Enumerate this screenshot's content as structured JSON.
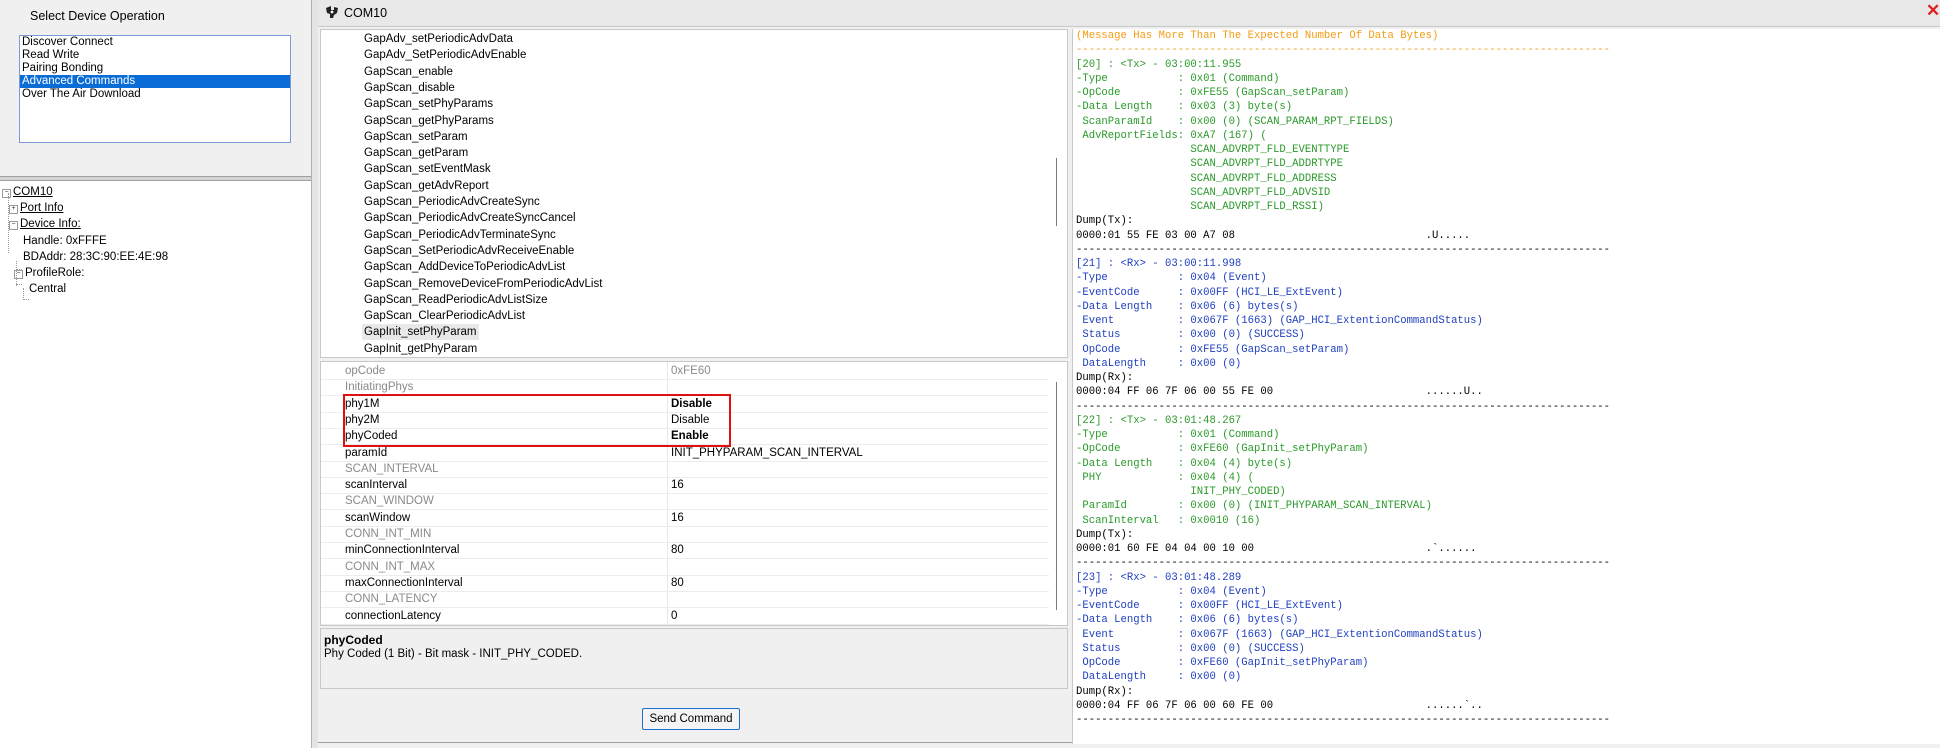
{
  "ops_panel": {
    "title": "Select Device Operation",
    "items": [
      "Discover Connect",
      "Read Write",
      "Pairing Bonding",
      "Advanced Commands",
      "Over The Air Download"
    ],
    "selected_index": 3
  },
  "tree": {
    "root": "COM10",
    "port_info": "Port Info",
    "device_info": "Device Info:",
    "handle": "Handle: 0xFFFE",
    "bdaddr": "BDAddr: 28:3C:90:EE:4E:98",
    "profile_role": "ProfileRole:",
    "role": "Central"
  },
  "window": {
    "title": "COM10"
  },
  "commands": {
    "items": [
      "GapAdv_setPeriodicAdvData",
      "GapAdv_SetPeriodicAdvEnable",
      "GapScan_enable",
      "GapScan_disable",
      "GapScan_setPhyParams",
      "GapScan_getPhyParams",
      "GapScan_setParam",
      "GapScan_getParam",
      "GapScan_setEventMask",
      "GapScan_getAdvReport",
      "GapScan_PeriodicAdvCreateSync",
      "GapScan_PeriodicAdvCreateSyncCancel",
      "GapScan_PeriodicAdvTerminateSync",
      "GapScan_SetPeriodicAdvReceiveEnable",
      "GapScan_AddDeviceToPeriodicAdvList",
      "GapScan_RemoveDeviceFromPeriodicAdvList",
      "GapScan_ReadPeriodicAdvListSize",
      "GapScan_ClearPeriodicAdvList",
      "GapInit_setPhyParam",
      "GapInit_getPhyParam"
    ],
    "selected_index": 18
  },
  "properties": {
    "rows": [
      {
        "name": "opCode",
        "value": "0xFE60",
        "style": "cat"
      },
      {
        "name": "InitiatingPhys",
        "value": "",
        "style": "cat"
      },
      {
        "name": "phy1M",
        "value": "Disable",
        "style": "bold"
      },
      {
        "name": "phy2M",
        "value": "Disable",
        "style": "normal"
      },
      {
        "name": "phyCoded",
        "value": "Enable",
        "style": "bold"
      },
      {
        "name": "paramId",
        "value": "INIT_PHYPARAM_SCAN_INTERVAL",
        "style": "normal"
      },
      {
        "name": "SCAN_INTERVAL",
        "value": "",
        "style": "cat"
      },
      {
        "name": "scanInterval",
        "value": "16",
        "style": "normal"
      },
      {
        "name": "SCAN_WINDOW",
        "value": "",
        "style": "cat"
      },
      {
        "name": "scanWindow",
        "value": "16",
        "style": "normal"
      },
      {
        "name": "CONN_INT_MIN",
        "value": "",
        "style": "cat"
      },
      {
        "name": "minConnectionInterval",
        "value": "80",
        "style": "normal"
      },
      {
        "name": "CONN_INT_MAX",
        "value": "",
        "style": "cat"
      },
      {
        "name": "maxConnectionInterval",
        "value": "80",
        "style": "normal"
      },
      {
        "name": "CONN_LATENCY",
        "value": "",
        "style": "cat"
      },
      {
        "name": "connectionLatency",
        "value": "0",
        "style": "normal"
      }
    ]
  },
  "description": {
    "title": "phyCoded",
    "text": "Phy Coded (1 Bit) - Bit mask - INIT_PHY_CODED."
  },
  "send_button": "Send Command",
  "log": {
    "lines": [
      {
        "t": "(Message Has More Than The Expected Number Of Data Bytes)",
        "c": "orange"
      },
      {
        "t": "------------------------------------------------------------------------------------",
        "c": "orange"
      },
      {
        "t": "[20] : <Tx> - 03:00:11.955",
        "c": "green"
      },
      {
        "t": "-Type           : 0x01 (Command)",
        "c": "green"
      },
      {
        "t": "-OpCode         : 0xFE55 (GapScan_setParam)",
        "c": "green"
      },
      {
        "t": "-Data Length    : 0x03 (3) byte(s)",
        "c": "green"
      },
      {
        "t": " ScanParamId    : 0x00 (0) (SCAN_PARAM_RPT_FIELDS)",
        "c": "green"
      },
      {
        "t": " AdvReportFields: 0xA7 (167) (",
        "c": "green"
      },
      {
        "t": "                  SCAN_ADVRPT_FLD_EVENTTYPE",
        "c": "green"
      },
      {
        "t": "                  SCAN_ADVRPT_FLD_ADDRTYPE",
        "c": "green"
      },
      {
        "t": "                  SCAN_ADVRPT_FLD_ADDRESS",
        "c": "green"
      },
      {
        "t": "                  SCAN_ADVRPT_FLD_ADVSID",
        "c": "green"
      },
      {
        "t": "                  SCAN_ADVRPT_FLD_RSSI)",
        "c": "green"
      },
      {
        "t": "Dump(Tx):",
        "c": "black"
      },
      {
        "t": "0000:01 55 FE 03 00 A7 08                              .U.....",
        "c": "black"
      },
      {
        "t": "------------------------------------------------------------------------------------",
        "c": "black"
      },
      {
        "t": "[21] : <Rx> - 03:00:11.998",
        "c": "blue"
      },
      {
        "t": "-Type           : 0x04 (Event)",
        "c": "blue"
      },
      {
        "t": "-EventCode      : 0x00FF (HCI_LE_ExtEvent)",
        "c": "blue"
      },
      {
        "t": "-Data Length    : 0x06 (6) bytes(s)",
        "c": "blue"
      },
      {
        "t": " Event          : 0x067F (1663) (GAP_HCI_ExtentionCommandStatus)",
        "c": "blue"
      },
      {
        "t": " Status         : 0x00 (0) (SUCCESS)",
        "c": "blue"
      },
      {
        "t": " OpCode         : 0xFE55 (GapScan_setParam)",
        "c": "blue"
      },
      {
        "t": " DataLength     : 0x00 (0)",
        "c": "blue"
      },
      {
        "t": "Dump(Rx):",
        "c": "black"
      },
      {
        "t": "0000:04 FF 06 7F 06 00 55 FE 00                        ......U..",
        "c": "black"
      },
      {
        "t": "------------------------------------------------------------------------------------",
        "c": "black"
      },
      {
        "t": "[22] : <Tx> - 03:01:48.267",
        "c": "green"
      },
      {
        "t": "-Type           : 0x01 (Command)",
        "c": "green"
      },
      {
        "t": "-OpCode         : 0xFE60 (GapInit_setPhyParam)",
        "c": "green"
      },
      {
        "t": "-Data Length    : 0x04 (4) byte(s)",
        "c": "green"
      },
      {
        "t": " PHY            : 0x04 (4) (",
        "c": "green"
      },
      {
        "t": "                  INIT_PHY_CODED)",
        "c": "green"
      },
      {
        "t": " ParamId        : 0x00 (0) (INIT_PHYPARAM_SCAN_INTERVAL)",
        "c": "green"
      },
      {
        "t": " ScanInterval   : 0x0010 (16)",
        "c": "green"
      },
      {
        "t": "Dump(Tx):",
        "c": "black"
      },
      {
        "t": "0000:01 60 FE 04 04 00 10 00                           .`......",
        "c": "black"
      },
      {
        "t": "------------------------------------------------------------------------------------",
        "c": "black"
      },
      {
        "t": "[23] : <Rx> - 03:01:48.289",
        "c": "blue"
      },
      {
        "t": "-Type           : 0x04 (Event)",
        "c": "blue"
      },
      {
        "t": "-EventCode      : 0x00FF (HCI_LE_ExtEvent)",
        "c": "blue"
      },
      {
        "t": "-Data Length    : 0x06 (6) bytes(s)",
        "c": "blue"
      },
      {
        "t": " Event          : 0x067F (1663) (GAP_HCI_ExtentionCommandStatus)",
        "c": "blue"
      },
      {
        "t": " Status         : 0x00 (0) (SUCCESS)",
        "c": "blue"
      },
      {
        "t": " OpCode         : 0xFE60 (GapInit_setPhyParam)",
        "c": "blue"
      },
      {
        "t": " DataLength     : 0x00 (0)",
        "c": "blue"
      },
      {
        "t": "Dump(Rx):",
        "c": "black"
      },
      {
        "t": "0000:04 FF 06 7F 06 00 60 FE 00                        ......`..",
        "c": "black"
      },
      {
        "t": "------------------------------------------------------------------------------------",
        "c": "black"
      }
    ]
  },
  "colors": {
    "selection": "#0a6cd6",
    "highlight_box": "#e01010",
    "log_tx": "#2a9a2a",
    "log_rx": "#1f3fbf",
    "log_warning": "#f39c12"
  },
  "icons": {
    "app": "ti-logo-icon",
    "close": "close-icon"
  }
}
